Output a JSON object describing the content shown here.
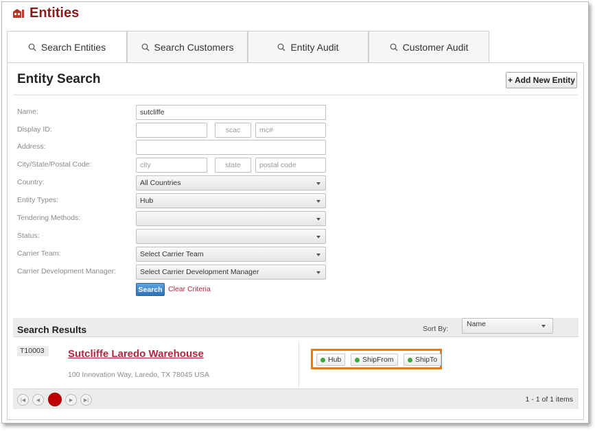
{
  "app": {
    "title": "Entities",
    "colors": {
      "brand": "#8b1a1a",
      "link": "#b3263e",
      "primary_button": "#2d73b8",
      "highlight": "#e57a16",
      "status_dot": "#3ca83c"
    }
  },
  "tabs": [
    {
      "label": "Search Entities",
      "icon": "search-icon",
      "active": true
    },
    {
      "label": "Search Customers",
      "icon": "search-icon",
      "active": false
    },
    {
      "label": "Entity Audit",
      "icon": "search-icon",
      "active": false
    },
    {
      "label": "Customer Audit",
      "icon": "search-icon",
      "active": false
    }
  ],
  "search": {
    "title": "Entity Search",
    "add_button": "+ Add New Entity",
    "labels": {
      "name": "Name:",
      "display_id": "Display ID:",
      "address": "Address:",
      "city_state_postal": "City/State/Postal Code:",
      "country": "Country:",
      "entity_types": "Entity Types:",
      "tendering_methods": "Tendering Methods:",
      "status": "Status:",
      "carrier_team": "Carrier Team:",
      "carrier_dev_manager": "Carrier Development Manager:"
    },
    "values": {
      "name": "sutcliffe",
      "display_id": "",
      "address": "",
      "city": "",
      "state": "",
      "postal": "",
      "country": "All Countries",
      "entity_types": "Hub",
      "tendering_methods": "",
      "status": "",
      "carrier_team": "Select Carrier Team",
      "carrier_dev_manager": "Select Carrier Development Manager"
    },
    "placeholders": {
      "scac": "scac",
      "mc": "mc#",
      "city": "city",
      "state": "state",
      "postal": "postal code"
    },
    "search_button": "Search",
    "clear_link": "Clear Criteria"
  },
  "results": {
    "title": "Search Results",
    "sort_label": "Sort By:",
    "sort_value": "Name",
    "rows": [
      {
        "id": "T10003",
        "name": "Sutcliffe Laredo Warehouse",
        "address": "100 Innovation Way, Laredo, TX 78045 USA",
        "types": [
          "Hub",
          "ShipFrom",
          "ShipTo"
        ]
      }
    ],
    "pager": {
      "current_page": "1",
      "info": "1 - 1 of 1 items"
    }
  }
}
